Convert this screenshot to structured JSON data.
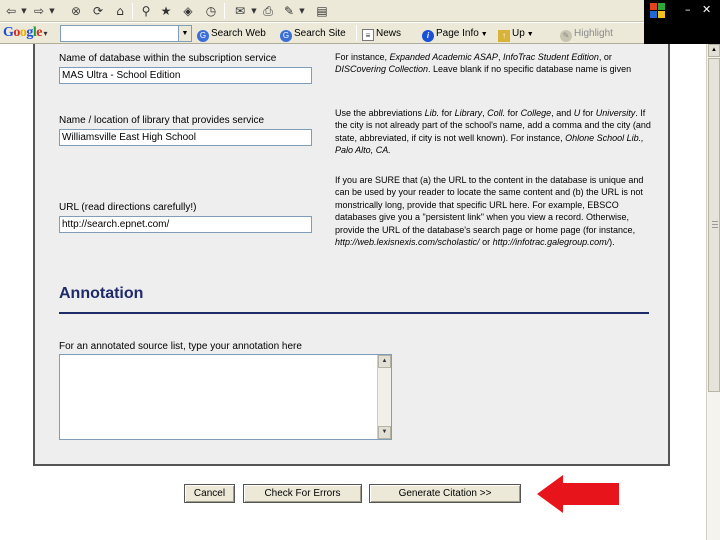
{
  "toolbar": {
    "icons": [
      "back-icon",
      "forward-icon",
      "stop-icon",
      "refresh-icon",
      "home-icon",
      "search-icon",
      "favorites-icon",
      "history-icon",
      "mail-icon",
      "print-icon",
      "edit-icon",
      "discuss-icon"
    ]
  },
  "google_bar": {
    "logo": "Google",
    "search_value": "",
    "search_web": "Search Web",
    "search_site": "Search Site",
    "news": "News",
    "page_info": "Page Info",
    "up": "Up",
    "highlight": "Highlight"
  },
  "window_controls": {
    "minimize": "–",
    "close": "✕"
  },
  "form": {
    "database_name_label": "Name of database within the subscription service",
    "database_name_value": "MAS Ultra - School Edition",
    "library_label": "Name / location of library that provides service",
    "library_value": "Williamsville East High School",
    "url_label": "URL (read directions carefully!)",
    "url_value": "http://search.epnet.com/",
    "database_help": {
      "p1": "For instance, ",
      "e1": "Expanded Academic ASAP",
      "p2": ", ",
      "e2": "InfoTrac Student Edition",
      "p3": ", or ",
      "e3": "DISCovering Collection",
      "p4": ". Leave blank if no specific database name is given"
    },
    "library_help": {
      "p1": "Use the abbreviations ",
      "e1": "Lib.",
      "p2": " for ",
      "e2": "Library",
      "p3": ", ",
      "e3": "Coll.",
      "p4": " for ",
      "e4": "College",
      "p5": ", and ",
      "e5": "U",
      "p6": " for ",
      "e6": "University",
      "p7": ". If the city is not already part of the school's name, add a comma and the city (and state, abbreviated, if city is not well known). For instance, ",
      "e7": "Ohlone School Lib., Palo Alto, CA."
    },
    "url_help": {
      "p1": "If you are SURE that (a) the URL to the content in the database is unique and can be used by your reader to locate the same content and (b) the URL is not monstrically long, provide that specific URL here. For example, EBSCO databases give you a \"persistent link\" when you view a record. Otherwise, provide the URL of the database's search page or home page (for instance, ",
      "e1": "http://web.lexisnexis.com/scholastic/",
      "p2": " or ",
      "e2": "http://infotrac.galegroup.com/",
      "p3": ")."
    },
    "annotation_heading": "Annotation",
    "annotation_label": "For an annotated source list, type your annotation here",
    "annotation_value": ""
  },
  "buttons": {
    "cancel": "Cancel",
    "check_errors": "Check For Errors",
    "generate": "Generate Citation >>"
  },
  "colors": {
    "heading": "#1f2a6b",
    "arrow": "#e8141c",
    "form_bg": "#eeeeee",
    "chrome": "#ece9d8"
  }
}
